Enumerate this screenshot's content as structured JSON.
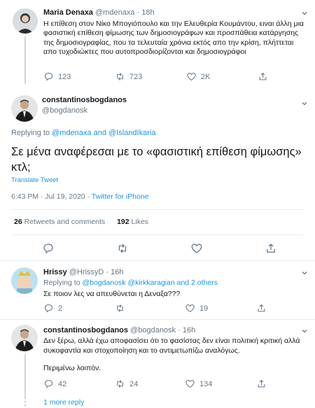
{
  "tweet1": {
    "display_name": "Maria Denaxa",
    "handle": "@mdenaxa",
    "time": "· 18h",
    "text": "Η επίθεση στον Νίκο Μπογιόπουλο και την Ελευθερία Κουμάντου, ειναι άλλη μια φασιστική επίθεση φίμωσης των δημοσιογράφων και προσπάθεια κατάργησης της δημοσιογραφίας, που τα τελευταία χρόνια εκτός απο την κρίση, πλήττεται απο τυχοδιώκτες που αυτοπροσδιορίζονται και δημοσιογράφοι",
    "replies": "123",
    "retweets": "723",
    "likes": "2K"
  },
  "main_tweet": {
    "display_name": "constantinosbogdanos",
    "handle": "@bogdanosk",
    "replying_prefix": "Replying to",
    "replying_user1": "@mdenaxa",
    "replying_and": "and",
    "replying_user2": "@IslandIkaria",
    "text": "Σε μένα αναφέρεσαι με το «φασιστική επίθεση φίμωσης» κτλ;",
    "translate": "Translate Tweet",
    "timestamp": "6:43 PM · Jul 19, 2020 ·",
    "source": "Twitter for iPhone",
    "retweets_count": "26",
    "retweets_label": "Retweets and comments",
    "likes_count": "192",
    "likes_label": "Likes"
  },
  "reply1": {
    "display_name": "Hrissy",
    "handle": "@HrissyD",
    "time": "· 16h",
    "replying_prefix": "Replying to",
    "replying_user1": "@bogdanosk",
    "replying_user2": "@kirkkaragian",
    "replying_rest": "and 2 others",
    "text": "Σε ποιον λες να απευθύνεται η Δεναξα???",
    "replies": "2",
    "likes": "19"
  },
  "reply2": {
    "display_name": "constantinosbogdanos",
    "handle": "@bogdanosk",
    "time": "· 16h",
    "text": "Δεν ξέρω, αλλά έχω αποφασίσει ότι το φασίστας δεν είναι πολιτική κριτική αλλά συκοφαντία και στοχοποίηση και το αντιμετωπίζω αναλόγως.",
    "text2": "Περιμένω λοιπόν.",
    "replies": "42",
    "retweets": "24",
    "likes": "134"
  },
  "more_reply": "1 more reply",
  "colors": {
    "accent": "#1b95e0",
    "muted": "#657786",
    "divider": "#e6ecf0"
  }
}
